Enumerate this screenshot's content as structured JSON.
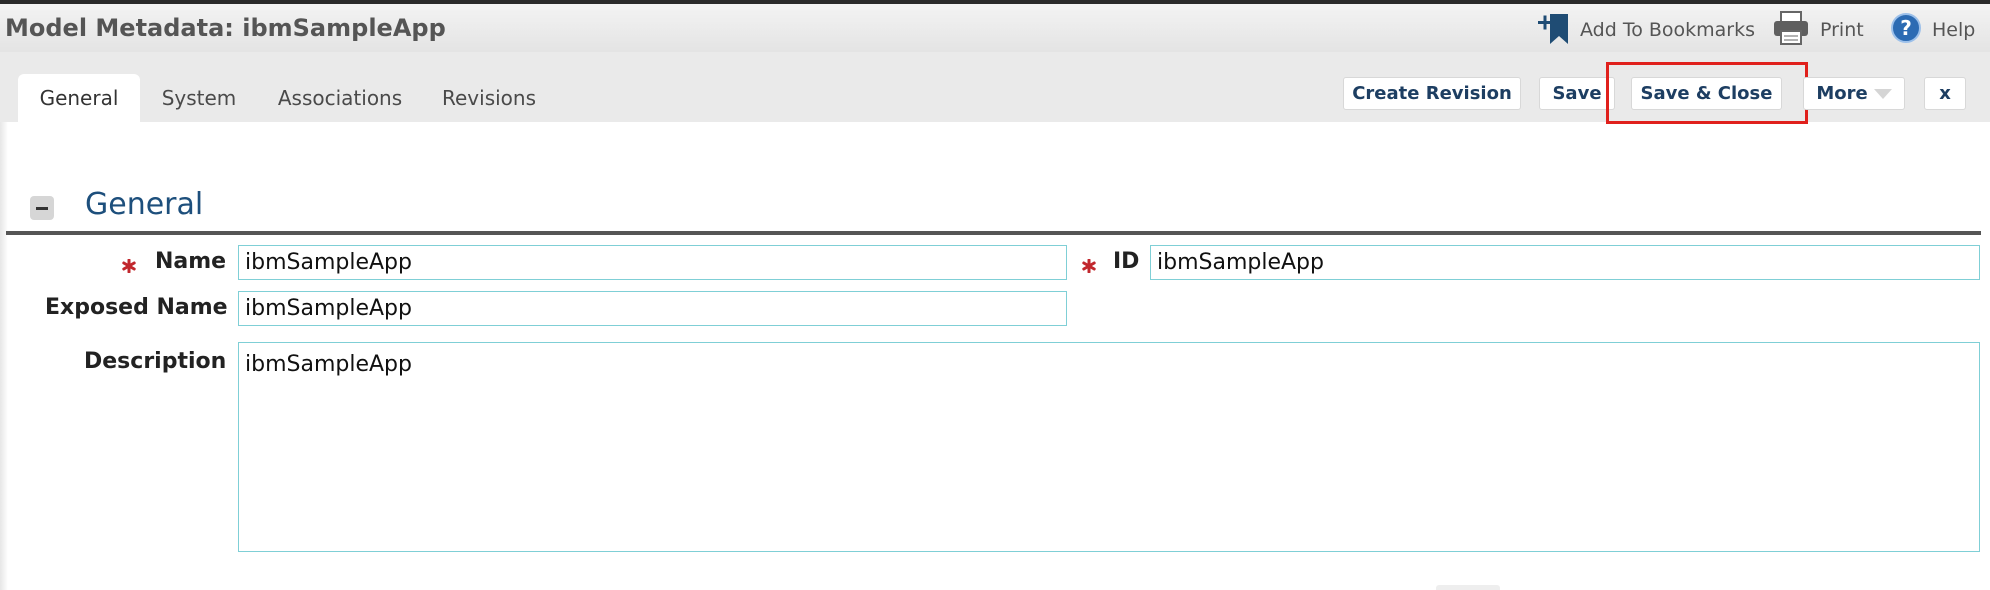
{
  "header": {
    "title": "Model Metadata: ibmSampleApp",
    "bookmarks_label": "Add To Bookmarks",
    "print_label": "Print",
    "help_label": "Help"
  },
  "tabs": [
    {
      "label": "General",
      "active": true
    },
    {
      "label": "System",
      "active": false
    },
    {
      "label": "Associations",
      "active": false
    },
    {
      "label": "Revisions",
      "active": false
    }
  ],
  "toolbar": {
    "create_revision_label": "Create Revision",
    "save_label": "Save",
    "save_close_label": "Save & Close",
    "more_label": "More",
    "close_label": "x"
  },
  "section": {
    "title": "General",
    "fields": {
      "name": {
        "label": "Name",
        "value": "ibmSampleApp",
        "required": true
      },
      "id": {
        "label": "ID",
        "value": "ibmSampleApp",
        "required": true
      },
      "exposed_name": {
        "label": "Exposed Name",
        "value": "ibmSampleApp"
      },
      "description": {
        "label": "Description",
        "value": "ibmSampleApp"
      }
    }
  },
  "colors": {
    "title_text": "#555555",
    "section_title": "#1d4f7c",
    "button_text": "#1d3e62",
    "required_star": "#c1272d",
    "field_border": "#7fcfd6",
    "highlight_box": "#e0201c"
  },
  "icons": {
    "bookmarks": "bookmark-add-icon",
    "print": "printer-icon",
    "help": "help-icon",
    "collapse": "collapse-minus-icon",
    "required": "required-asterisk-icon"
  }
}
